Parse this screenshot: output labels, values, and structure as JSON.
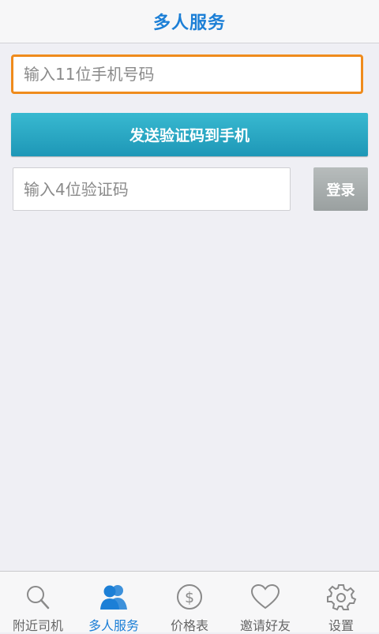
{
  "header": {
    "title": "多人服务"
  },
  "form": {
    "phone_placeholder": "输入11位手机号码",
    "send_code_label": "发送验证码到手机",
    "code_placeholder": "输入4位验证码",
    "login_label": "登录"
  },
  "tabs": [
    {
      "label": "附近司机",
      "icon": "search-icon",
      "active": false
    },
    {
      "label": "多人服务",
      "icon": "people-icon",
      "active": true
    },
    {
      "label": "价格表",
      "icon": "dollar-icon",
      "active": false
    },
    {
      "label": "邀请好友",
      "icon": "heart-icon",
      "active": false
    },
    {
      "label": "设置",
      "icon": "gear-icon",
      "active": false
    }
  ],
  "colors": {
    "accent": "#1c7fd6",
    "input_focus_border": "#ef8b1c",
    "send_button": "#2aa8c4",
    "login_button": "#a8adad",
    "background": "#efeff4"
  }
}
